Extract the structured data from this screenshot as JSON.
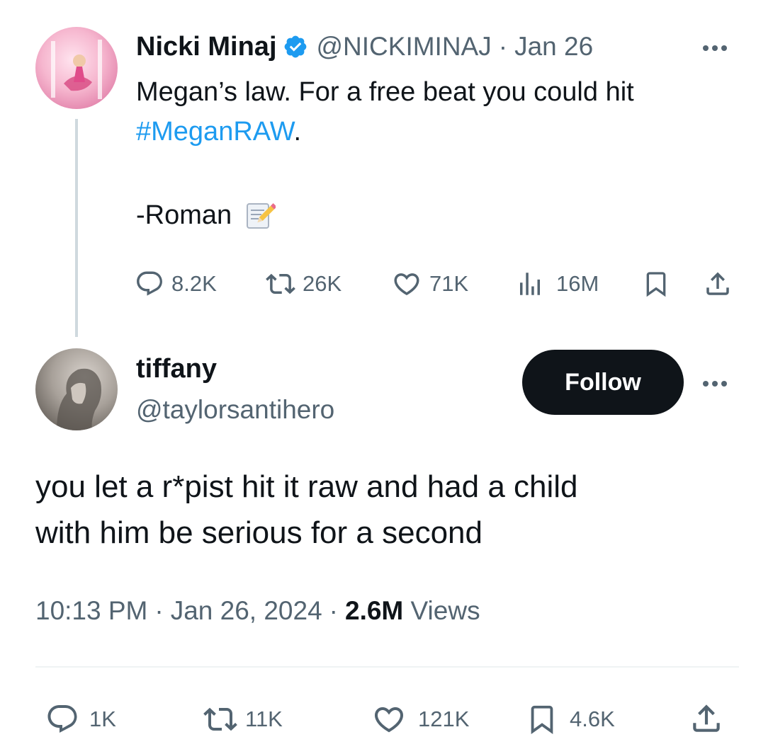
{
  "quoted_tweet": {
    "display_name": "Nicki Minaj",
    "handle": "@NICKIMINAJ",
    "separator": "·",
    "date": "Jan 26",
    "text_line1": "Megan’s law. For a free beat you could hit",
    "hashtag": "#MeganRAW",
    "hashtag_suffix": ".",
    "signature": "-Roman",
    "signature_emoji": "memo-icon",
    "metrics": {
      "replies": "8.2K",
      "reposts": "26K",
      "likes": "71K",
      "views": "16M"
    }
  },
  "reply_tweet": {
    "display_name": "tiffany",
    "handle": "@taylorsantihero",
    "follow_label": "Follow",
    "text_line1": "you let a r*pist hit it raw and had a child",
    "text_line2": "with him be serious for a second",
    "time": "10:13 PM",
    "sep1": "·",
    "date": "Jan 26, 2024",
    "sep2": "·",
    "views_count": "2.6M",
    "views_label": "Views",
    "metrics": {
      "replies": "1K",
      "reposts": "11K",
      "likes": "121K",
      "bookmarks": "4.6K"
    }
  },
  "colors": {
    "text": "#0f1419",
    "muted": "#536471",
    "link": "#1d9bf0",
    "verified": "#1d9bf0",
    "follow_bg": "#0f1419"
  }
}
